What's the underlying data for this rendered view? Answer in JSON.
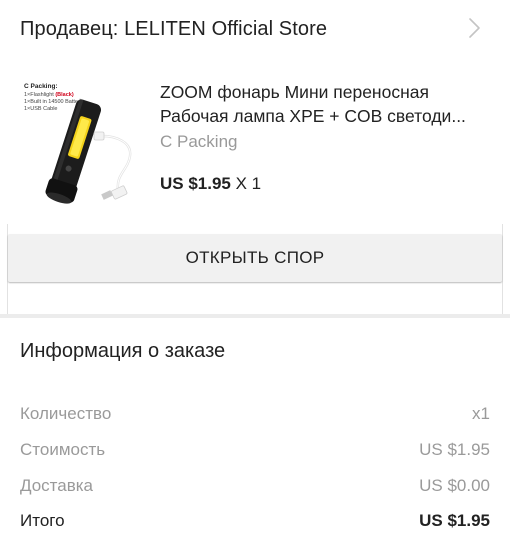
{
  "seller": {
    "label": "Продавец: LELITEN Official Store",
    "chevron_icon": "chevron-right-icon"
  },
  "product": {
    "title_line1": "ZOOM фонарь Мини переносная",
    "title_line2": "Рабочая лампа XPE + COB светоди...",
    "variant": "C Packing",
    "price": "US $1.95",
    "quantity": "X 1",
    "image": {
      "packing_title": "C Packing:",
      "packing_line1_prefix": "1×Flashlight ",
      "packing_line1_highlight": "(Black)",
      "packing_line2": "1×Built in 14500 Battery",
      "packing_line3": "1×USB Cable",
      "highlight_color": "#d0021b"
    }
  },
  "dispute": {
    "button_label": "ОТКРЫТЬ СПОР"
  },
  "order_info": {
    "title": "Информация о заказе",
    "rows": [
      {
        "label": "Количество",
        "value": "x1"
      },
      {
        "label": "Стоимость",
        "value": "US $1.95"
      },
      {
        "label": "Доставка",
        "value": "US $0.00"
      },
      {
        "label": "Итого",
        "value": "US $1.95"
      }
    ]
  }
}
